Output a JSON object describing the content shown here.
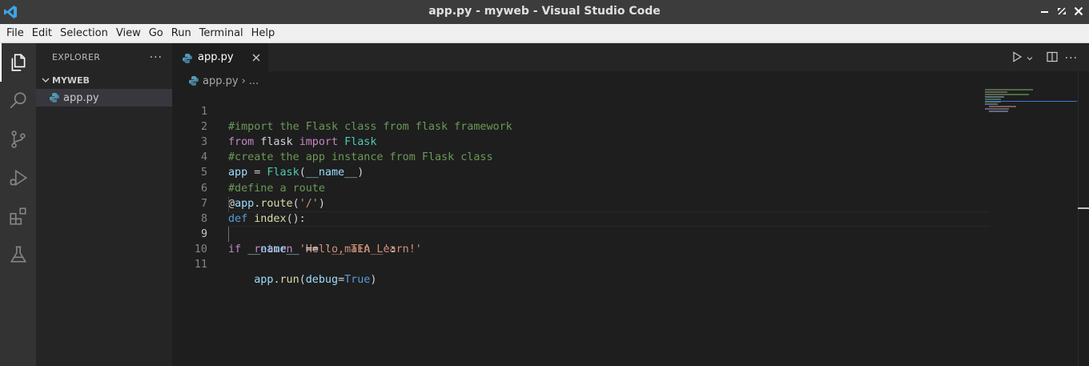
{
  "window": {
    "title": "app.py - myweb - Visual Studio Code"
  },
  "menu": [
    "File",
    "Edit",
    "Selection",
    "View",
    "Go",
    "Run",
    "Terminal",
    "Help"
  ],
  "activity_bar": [
    "explorer-icon",
    "search-icon",
    "source-control-icon",
    "run-debug-icon",
    "extensions-icon",
    "testing-icon"
  ],
  "sidebar": {
    "title": "EXPLORER",
    "folder": "MYWEB",
    "files": [
      "app.py"
    ]
  },
  "editor": {
    "tab_label": "app.py",
    "breadcrumb_file": "app.py",
    "breadcrumb_rest": "...",
    "current_line": 9,
    "line_numbers": [
      "1",
      "2",
      "3",
      "4",
      "5",
      "6",
      "7",
      "8",
      "9",
      "10",
      "11"
    ]
  },
  "code": {
    "l1": "#import the Flask class from flask framework",
    "l2_from": "from",
    "l2_mod": " flask ",
    "l2_import": "import",
    "l2_cls": " Flask",
    "l3": "#create the app instance from Flask class",
    "l4_var": "app",
    "l4_eq": " = ",
    "l4_cls": "Flask",
    "l4_open": "(",
    "l4_arg": "__name__",
    "l4_close": ")",
    "l5": "#define a route",
    "l6_at": "@",
    "l6_var": "app",
    "l6_dot": ".",
    "l6_fn": "route",
    "l6_open": "(",
    "l6_str": "'/'",
    "l6_close": ")",
    "l7_def": "def",
    "l7_sp": " ",
    "l7_fn": "index",
    "l7_rest": "():",
    "l8_ind": "    ",
    "l8_ret": "return",
    "l8_sp": " ",
    "l8_str": "'Hello, TEA Learn!'",
    "l9_if": "if",
    "l9_sp": " ",
    "l9_var": "__name__",
    "l9_eq": " == ",
    "l9_str": "'__main__'",
    "l9_colon": ":",
    "l10_ind": "    ",
    "l10_var": "app",
    "l10_dot": ".",
    "l10_fn": "run",
    "l10_open": "(",
    "l10_kw": "debug",
    "l10_eq": "=",
    "l10_true": "True",
    "l10_close": ")"
  },
  "colors": {
    "keyword": "#c586c0",
    "builtin": "#569cd6",
    "comment": "#6a9955",
    "class": "#4ec9b0",
    "variable": "#9cdcfe",
    "function": "#dcdcaa",
    "string": "#ce9178"
  }
}
